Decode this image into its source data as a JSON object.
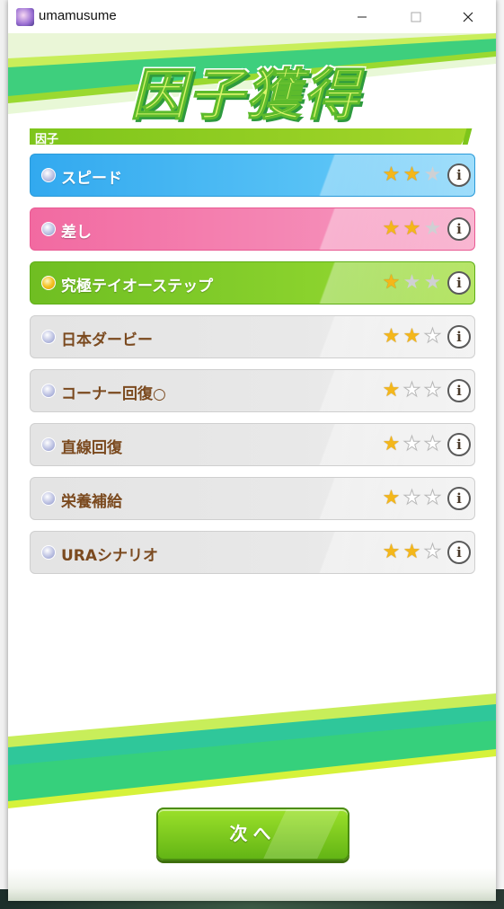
{
  "window": {
    "title": "umamusume",
    "min_glyph": "—",
    "max_glyph": "☐",
    "close_glyph": "✕"
  },
  "banner": {
    "title": "因子獲得"
  },
  "section": {
    "label": "因子"
  },
  "factors": [
    {
      "name": "スピード",
      "stars": 2,
      "color": "blue"
    },
    {
      "name": "差し",
      "stars": 2,
      "color": "pink"
    },
    {
      "name": "究極テイオーステップ",
      "stars": 1,
      "color": "green",
      "gem": "gold"
    },
    {
      "name": "日本ダービー",
      "stars": 2,
      "color": "gray"
    },
    {
      "name": "コーナー回復○",
      "stars": 1,
      "color": "gray"
    },
    {
      "name": "直線回復",
      "stars": 1,
      "color": "gray"
    },
    {
      "name": "栄養補給",
      "stars": 1,
      "color": "gray"
    },
    {
      "name": "URAシナリオ",
      "stars": 2,
      "color": "gray"
    }
  ],
  "info_glyph": "i",
  "next_button": {
    "label": "次へ"
  },
  "colors": {
    "accent_green": "#7ec51b",
    "speed_blue": "#32a9ef",
    "style_pink": "#f26aa1",
    "unique_green": "#6fbe22",
    "star_gold": "#f4b71a"
  }
}
